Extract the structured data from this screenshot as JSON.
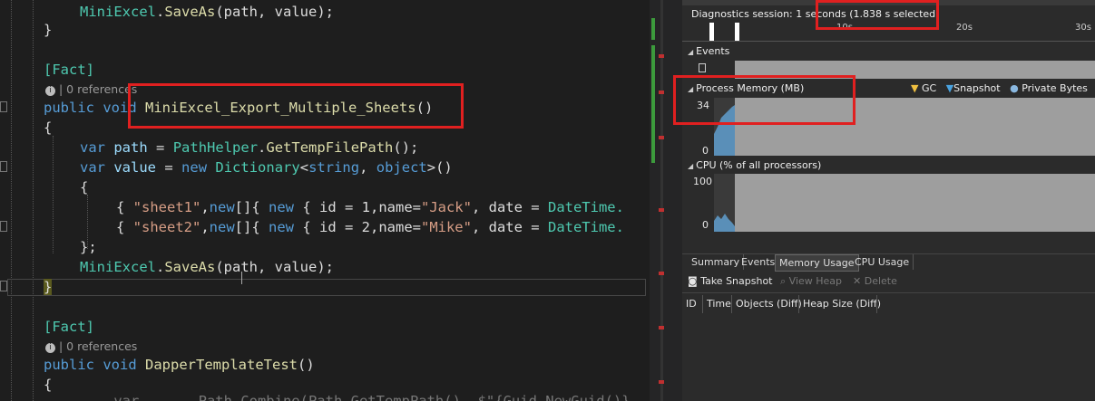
{
  "editor": {
    "lines": {
      "save_as_top": [
        "MiniExcel",
        ".",
        "SaveAs",
        "(path, value);"
      ],
      "close_brace_1": "}",
      "fact_1": "[Fact]",
      "codelens_1": "0 references",
      "sig_1": [
        "public",
        "void",
        "MiniExcel_Export_Multiple_Sheets",
        "()"
      ],
      "open_brace_1": "{",
      "var_path": [
        "var",
        "path",
        "=",
        "PathHelper",
        ".",
        "GetTempFilePath",
        "();"
      ],
      "var_value": [
        "var",
        "value",
        "=",
        "new",
        "Dictionary",
        "<",
        "string",
        ",",
        "object",
        ">()"
      ],
      "open_brace_2": "{",
      "sheet1": [
        "{ ",
        "\"sheet1\"",
        ",",
        "new",
        "[]{ ",
        "new",
        " { id = 1,name=",
        "\"Jack\"",
        ", date = ",
        "DateTime."
      ],
      "sheet2": [
        "{ ",
        "\"sheet2\"",
        ",",
        "new",
        "[]{ ",
        "new",
        " { id = 2,name=",
        "\"Mike\"",
        ", date = ",
        "DateTime."
      ],
      "close_dict": "};",
      "save_as": [
        "MiniExcel",
        ".",
        "SaveAs",
        "(path, value);"
      ],
      "close_brace_cursor": "}",
      "fact_2": "[Fact]",
      "codelens_2": "0 references",
      "sig_2": [
        "public",
        "void",
        "DapperTemplateTest",
        "()"
      ],
      "open_brace_3": "{",
      "partial": "    var  ...  Path.Combine(Path.GetTempPath(), $\"{Guid.NewGuid()}"
    }
  },
  "diagnostics": {
    "session_label": "Diagnostics session: 1 seconds (1.838 s selected)",
    "timeline_ticks": [
      "10s",
      "20s",
      "30s"
    ],
    "events_label": "Events",
    "memory": {
      "label": "Process Memory (MB)",
      "max_label": "34",
      "min_label": "0",
      "legend": {
        "gc": "GC",
        "snapshot": "Snapshot",
        "private_bytes": "Private Bytes"
      }
    },
    "cpu": {
      "label": "CPU (% of all processors)",
      "max_label": "100",
      "min_label": "0"
    },
    "tabs": [
      "Summary",
      "Events",
      "Memory Usage",
      "CPU Usage"
    ],
    "toolbar": {
      "take_snapshot": "Take Snapshot",
      "view_heap": "View Heap",
      "delete": "Delete"
    },
    "columns": [
      "ID",
      "Time",
      "Objects (Diff)",
      "Heap Size (Diff)"
    ]
  },
  "colors": {
    "highlight_box": "#e02020",
    "keyword": "#569cd6",
    "type": "#4ec9b0",
    "method": "#dcdcaa",
    "string": "#d69d85",
    "chart_fill": "#5a8fb8"
  }
}
